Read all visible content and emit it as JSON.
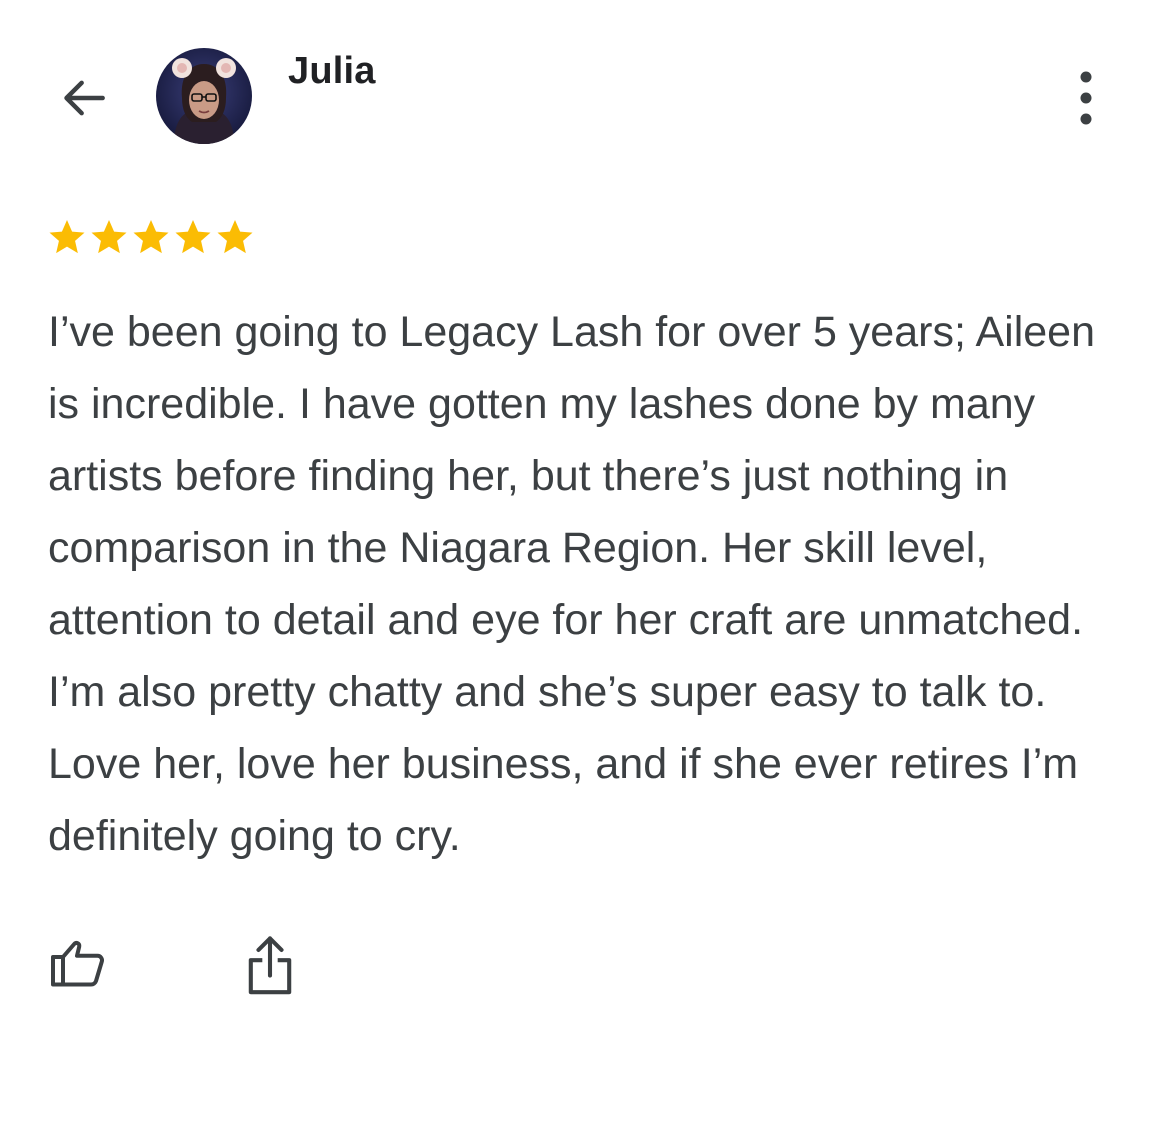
{
  "reviewer": {
    "name": "Julia"
  },
  "review": {
    "rating": 5,
    "rating_max": 5,
    "text": "I’ve been going to Legacy Lash for over 5 years; Aileen is incredible. I have gotten my lashes done by many artists before finding her, but there’s just nothing in comparison in the Niagara Region. Her skill level, attention to detail and eye for her craft are unmatched. I’m also pretty chatty and she’s super easy to talk to. Love her, love her business, and if she ever retires I’m definitely going to cry."
  },
  "icons": {
    "back": "arrow-left-icon",
    "more": "more-vertical-icon",
    "star": "star-icon",
    "like": "thumbs-up-icon",
    "share": "share-icon"
  },
  "colors": {
    "star": "#fbbc04",
    "text": "#3c4043",
    "name": "#202124",
    "icon": "#3c4043"
  }
}
